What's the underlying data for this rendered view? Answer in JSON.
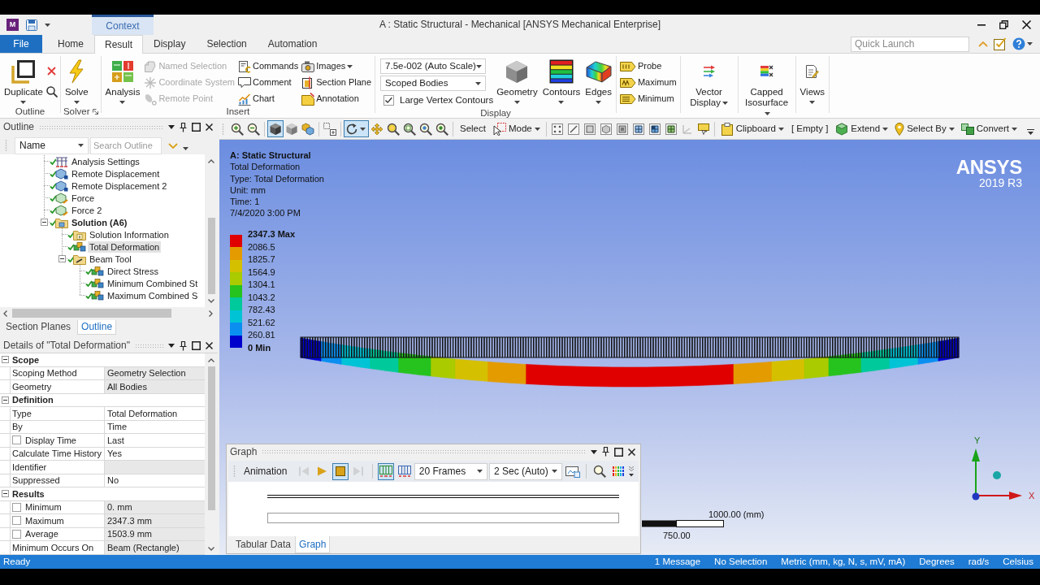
{
  "window": {
    "app_letter": "M",
    "context_label": "Context",
    "title": "A : Static Structural - Mechanical [ANSYS Mechanical Enterprise]"
  },
  "quick_launch": {
    "placeholder": "Quick Launch"
  },
  "ribbon_tabs": [
    {
      "label": "File",
      "kind": "file",
      "selected": false
    },
    {
      "label": "Home",
      "kind": "tab",
      "selected": false
    },
    {
      "label": "Result",
      "kind": "tab",
      "selected": true
    },
    {
      "label": "Display",
      "kind": "tab",
      "selected": false
    },
    {
      "label": "Selection",
      "kind": "tab",
      "selected": false
    },
    {
      "label": "Automation",
      "kind": "tab",
      "selected": false
    }
  ],
  "ribbon_groups": [
    {
      "label": "Outline",
      "items": [
        {
          "kind": "large",
          "label": "Duplicate",
          "dropdown": true
        },
        {
          "kind": "stack",
          "items": [
            {
              "kind": "icon"
            },
            {
              "kind": "icon"
            }
          ]
        }
      ]
    },
    {
      "label": "Solver",
      "launcher": true,
      "items": [
        {
          "kind": "large",
          "label": "Solve",
          "dropdown": true
        }
      ]
    },
    {
      "label": "Insert",
      "items": [
        {
          "kind": "large",
          "label": "Analysis",
          "dropdown": true
        },
        {
          "kind": "stack",
          "items": [
            {
              "kind": "small",
              "label": "Named Selection",
              "disabled": true,
              "dropdown": false
            },
            {
              "kind": "small",
              "label": "Coordinate System",
              "disabled": true,
              "dropdown": false
            },
            {
              "kind": "small",
              "label": "Remote Point",
              "disabled": true,
              "dropdown": false
            }
          ]
        },
        {
          "kind": "stack",
          "items": [
            {
              "kind": "small",
              "label": "Commands",
              "disabled": false,
              "dropdown": false
            },
            {
              "kind": "small",
              "label": "Comment",
              "disabled": false,
              "dropdown": false
            },
            {
              "kind": "small",
              "label": "Chart",
              "disabled": false,
              "dropdown": false
            }
          ]
        },
        {
          "kind": "stack",
          "items": [
            {
              "kind": "small",
              "label": "Images",
              "disabled": false,
              "dropdown": true
            },
            {
              "kind": "small",
              "label": "Section Plane",
              "disabled": false,
              "dropdown": false
            },
            {
              "kind": "small",
              "label": "Annotation",
              "disabled": false,
              "dropdown": false
            }
          ]
        }
      ]
    },
    {
      "label": "Display",
      "items": [
        {
          "kind": "stack",
          "items": [
            {
              "kind": "select",
              "value": "7.5e-002 (Auto Scale)"
            },
            {
              "kind": "select",
              "value": "Scoped Bodies"
            },
            {
              "kind": "checkbox",
              "label": "Large Vertex Contours",
              "checked": true
            }
          ]
        },
        {
          "kind": "large",
          "label": "Geometry",
          "dropdown": true
        },
        {
          "kind": "large",
          "label": "Contours",
          "dropdown": true
        },
        {
          "kind": "large",
          "label": "Edges",
          "dropdown": true
        }
      ]
    },
    {
      "items": [
        {
          "kind": "stack",
          "items": [
            {
              "kind": "small",
              "label": "Probe",
              "disabled": false,
              "dropdown": false
            },
            {
              "kind": "small",
              "label": "Maximum",
              "disabled": false,
              "dropdown": false
            },
            {
              "kind": "small",
              "label": "Minimum",
              "disabled": false,
              "dropdown": false
            }
          ]
        }
      ]
    },
    {
      "items": [
        {
          "kind": "large-wrapped",
          "label": "Vector Display",
          "dropdown": true
        }
      ]
    },
    {
      "items": [
        {
          "kind": "large-wrapped",
          "label": "Capped Isosurface",
          "dropdown": true
        }
      ]
    },
    {
      "items": [
        {
          "kind": "large",
          "label": "Views",
          "dropdown": true
        }
      ]
    }
  ],
  "view_toolbar": [
    {
      "kind": "icon",
      "pressed": false
    },
    {
      "kind": "icon",
      "pressed": false
    },
    {
      "kind": "separator"
    },
    {
      "kind": "icon",
      "pressed": true
    },
    {
      "kind": "icon",
      "pressed": false
    },
    {
      "kind": "icon",
      "pressed": false
    },
    {
      "kind": "separator"
    },
    {
      "kind": "icon",
      "pressed": false
    },
    {
      "kind": "separator"
    },
    {
      "kind": "icon-menu",
      "pressed": true
    },
    {
      "kind": "icon",
      "pressed": false
    },
    {
      "kind": "icon",
      "pressed": false
    },
    {
      "kind": "icon",
      "pressed": false
    },
    {
      "kind": "icon",
      "pressed": false
    },
    {
      "kind": "icon",
      "pressed": false
    },
    {
      "kind": "separator"
    },
    {
      "kind": "text",
      "label": "Select"
    },
    {
      "kind": "menu",
      "label": "Mode"
    },
    {
      "kind": "separator"
    },
    {
      "kind": "icon",
      "pressed": false
    },
    {
      "kind": "icon",
      "pressed": false
    },
    {
      "kind": "icon",
      "pressed": false
    },
    {
      "kind": "icon",
      "pressed": false
    },
    {
      "kind": "icon",
      "pressed": false
    },
    {
      "kind": "icon",
      "pressed": false
    },
    {
      "kind": "icon",
      "pressed": false
    },
    {
      "kind": "icon",
      "pressed": false
    },
    {
      "kind": "icon",
      "pressed": false
    },
    {
      "kind": "icon",
      "pressed": false
    },
    {
      "kind": "separator"
    },
    {
      "kind": "menu",
      "label": "Clipboard"
    },
    {
      "kind": "text",
      "label": "[ Empty ]"
    },
    {
      "kind": "menu",
      "label": "Extend"
    },
    {
      "kind": "menu",
      "label": "Select By"
    },
    {
      "kind": "menu",
      "label": "Convert"
    },
    {
      "kind": "overflow"
    }
  ],
  "outline_panel": {
    "title": "Outline",
    "filter": {
      "value": "Name"
    },
    "search": {
      "placeholder": "Search Outline"
    },
    "tree": [
      {
        "label": "Analysis Settings",
        "kind": "settings",
        "solved": true,
        "selected": false
      },
      {
        "label": "Remote Displacement",
        "kind": "support",
        "solved": true,
        "selected": false
      },
      {
        "label": "Remote Displacement 2",
        "kind": "support",
        "solved": true,
        "selected": false
      },
      {
        "label": "Force",
        "kind": "load",
        "solved": true,
        "selected": false
      },
      {
        "label": "Force 2",
        "kind": "load",
        "solved": true,
        "selected": false
      },
      {
        "label": "Solution (A6)",
        "kind": "solution",
        "solved": true,
        "selected": false,
        "expanded": true,
        "children": [
          {
            "label": "Solution Information",
            "kind": "info",
            "solved": true,
            "selected": false
          },
          {
            "label": "Total Deformation",
            "kind": "result",
            "solved": true,
            "selected": true
          },
          {
            "label": "Beam Tool",
            "kind": "tool",
            "solved": true,
            "selected": false,
            "expanded": true,
            "children": [
              {
                "label": "Direct Stress",
                "kind": "result",
                "solved": true,
                "selected": false
              },
              {
                "label": "Minimum Combined St",
                "kind": "result",
                "solved": true,
                "selected": false
              },
              {
                "label": "Maximum Combined S",
                "kind": "result",
                "solved": true,
                "selected": false
              }
            ]
          }
        ]
      }
    ],
    "tabs": [
      {
        "label": "Section Planes",
        "selected": false
      },
      {
        "label": "Outline",
        "selected": true
      }
    ]
  },
  "details_panel": {
    "title": "Details of \"Total Deformation\"",
    "sections": [
      {
        "label": "Scope",
        "expanded": true,
        "rows": [
          {
            "kind": "plain",
            "label": "Scoping Method",
            "value": "Geometry Selection",
            "shaded": true
          },
          {
            "kind": "plain",
            "label": "Geometry",
            "value": "All Bodies",
            "shaded": true
          }
        ]
      },
      {
        "label": "Definition",
        "expanded": true,
        "rows": [
          {
            "kind": "plain",
            "label": "Type",
            "value": "Total Deformation",
            "shaded": false
          },
          {
            "kind": "plain",
            "label": "By",
            "value": "Time",
            "shaded": false
          },
          {
            "kind": "checkbox",
            "checked": false,
            "label": "Display Time",
            "value": "Last",
            "shaded": false
          },
          {
            "kind": "plain",
            "label": "Calculate Time History",
            "value": "Yes",
            "shaded": false
          },
          {
            "kind": "plain",
            "label": "Identifier",
            "shaded": true
          },
          {
            "kind": "plain",
            "label": "Suppressed",
            "value": "No",
            "shaded": false
          }
        ]
      },
      {
        "label": "Results",
        "expanded": true,
        "rows": [
          {
            "kind": "checkbox",
            "checked": false,
            "label": "Minimum",
            "value": "0. mm",
            "shaded": true
          },
          {
            "kind": "checkbox",
            "checked": false,
            "label": "Maximum",
            "value": "2347.3 mm",
            "shaded": true
          },
          {
            "kind": "checkbox",
            "checked": false,
            "label": "Average",
            "value": "1503.9 mm",
            "shaded": true
          },
          {
            "kind": "plain",
            "label": "Minimum Occurs On",
            "value": "Beam (Rectangle)",
            "shaded": true
          }
        ]
      }
    ]
  },
  "viewport": {
    "info": [
      {
        "kind": "title",
        "text": "A: Static Structural"
      },
      {
        "kind": "line",
        "text": "Total Deformation"
      },
      {
        "kind": "line",
        "text": "Type: Total Deformation"
      },
      {
        "kind": "line",
        "text": "Unit: mm"
      },
      {
        "kind": "line",
        "text": "Time: 1"
      },
      {
        "kind": "line",
        "text": "7/4/2020 3:00 PM"
      }
    ],
    "legend": {
      "labels": [
        {
          "kind": "max",
          "text": "2347.3 Max"
        },
        {
          "kind": "value",
          "text": "2086.5"
        },
        {
          "kind": "value",
          "text": "1825.7"
        },
        {
          "kind": "value",
          "text": "1564.9"
        },
        {
          "kind": "value",
          "text": "1304.1"
        },
        {
          "kind": "value",
          "text": "1043.2"
        },
        {
          "kind": "value",
          "text": "782.43"
        },
        {
          "kind": "value",
          "text": "521.62"
        },
        {
          "kind": "value",
          "text": "260.81"
        },
        {
          "kind": "min",
          "text": "0 Min"
        }
      ],
      "bands": [
        {
          "color": "#e00000"
        },
        {
          "color": "#e39b00"
        },
        {
          "color": "#d5c000"
        },
        {
          "color": "#a9cb00"
        },
        {
          "color": "#26c21e"
        },
        {
          "color": "#00c99b"
        },
        {
          "color": "#00c3d6"
        },
        {
          "color": "#0a8ff0"
        },
        {
          "color": "#0000cc"
        }
      ]
    },
    "logo": {
      "brand": "ANSYS",
      "version": "2019 R3"
    },
    "triad": {
      "y_label": "Y",
      "x_label": "X"
    },
    "scale_bar": {
      "upper_label": "1000.00 (mm)",
      "lower_label": "750.00"
    }
  },
  "graph_panel": {
    "title": "Graph",
    "toolbar": {
      "label": "Animation",
      "buttons": [
        {
          "kind": "icon",
          "pressed": false,
          "disabled": true
        },
        {
          "kind": "icon",
          "pressed": false,
          "disabled": false
        },
        {
          "kind": "icon",
          "pressed": true,
          "disabled": false
        },
        {
          "kind": "icon",
          "pressed": false,
          "disabled": true
        },
        {
          "kind": "separator"
        },
        {
          "kind": "icon",
          "pressed": true,
          "disabled": false
        },
        {
          "kind": "icon",
          "pressed": false,
          "disabled": false
        },
        {
          "kind": "select",
          "value": "20 Frames"
        },
        {
          "kind": "select",
          "value": "2 Sec (Auto)"
        },
        {
          "kind": "icon",
          "pressed": false,
          "disabled": false
        },
        {
          "kind": "separator"
        },
        {
          "kind": "icon",
          "pressed": false,
          "disabled": false
        },
        {
          "kind": "icon",
          "pressed": false,
          "disabled": false
        }
      ]
    },
    "tabs": [
      {
        "label": "Tabular Data",
        "selected": false
      },
      {
        "label": "Graph",
        "selected": true
      }
    ]
  },
  "status_bar": {
    "message": "Ready",
    "items": [
      "1 Message",
      "No Selection",
      "Metric (mm, kg, N, s, mV, mA)",
      "Degrees",
      "rad/s",
      "Celsius"
    ]
  }
}
